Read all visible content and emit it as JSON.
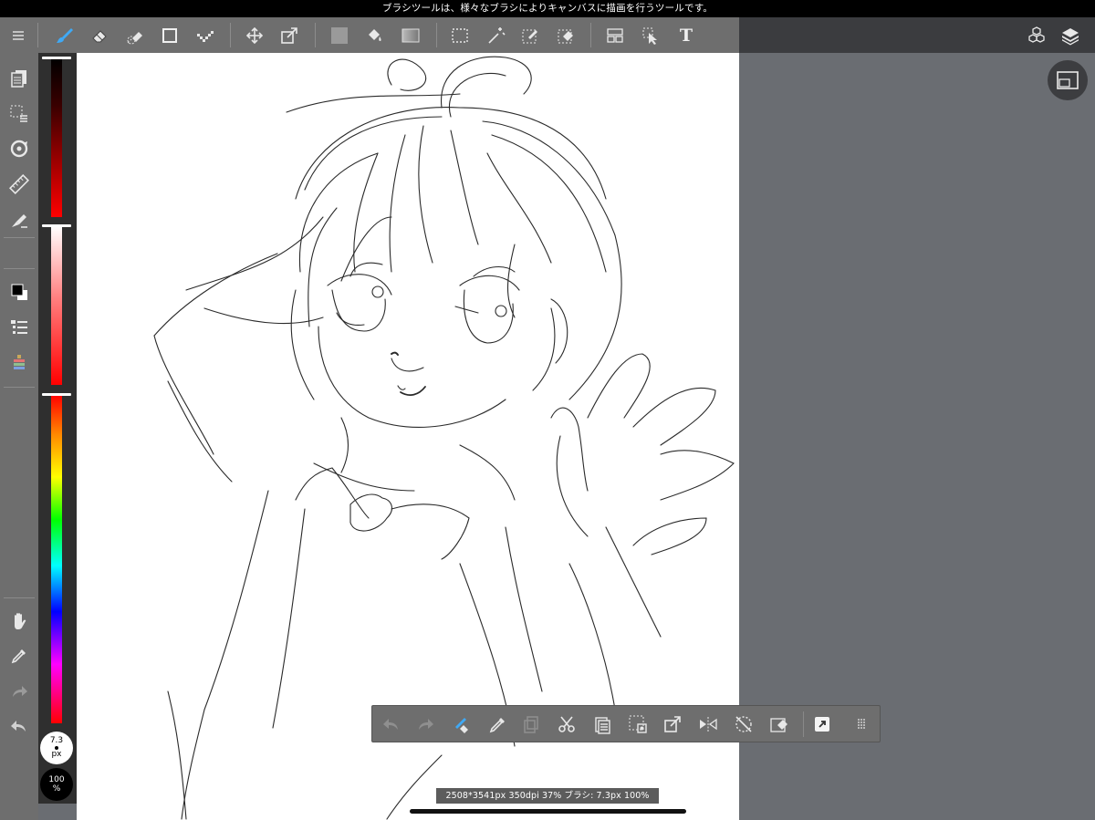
{
  "tip_bar": {
    "text": "ブラシツールは、様々なブラシによりキャンバスに描画を行うツールです。"
  },
  "toolbar": {
    "left_tools": [
      "menu-icon",
      "brush-icon",
      "eraser-icon",
      "blur-icon",
      "rectangle-icon",
      "dot-pen-icon"
    ],
    "transform_tools": [
      "move-icon",
      "transform-icon"
    ],
    "fill_tools": [
      "fill-color-icon",
      "bucket-icon",
      "gradient-icon"
    ],
    "select_tools": [
      "select-rect-icon",
      "magic-wand-icon",
      "select-pen-icon",
      "select-eraser-icon"
    ],
    "misc_tools": [
      "panel-icon",
      "operation-icon",
      "text-icon"
    ],
    "text_tool_label": "T",
    "right_tools": [
      "material-icon",
      "layers-icon"
    ]
  },
  "left_panel": {
    "items": [
      "page-icon",
      "selection-list-icon",
      "rotate-icon",
      "ruler-icon",
      "fill-pen-icon",
      "color-swatch-icon",
      "brush-list-icon",
      "color-palette-icon",
      "hand-icon",
      "eyedropper-icon",
      "redo-icon",
      "undo-icon"
    ]
  },
  "color_panel": {
    "brush_size_value": "7.3",
    "brush_size_unit": "px",
    "opacity_value": "100",
    "opacity_unit": "%",
    "current_color": "#000000",
    "secondary_color": "#ffffff"
  },
  "action_bar": {
    "items": [
      "undo-icon",
      "redo-icon",
      "clear-icon",
      "pen-icon",
      "copy-icon",
      "cut-icon",
      "paste-icon",
      "select-icon",
      "transform-icon",
      "flip-icon",
      "deselect-icon",
      "erase-selection-icon",
      "settings-icon",
      "grip-icon"
    ]
  },
  "info_bar": {
    "text": "2508*3541px 350dpi 37% ブラシ: 7.3px 100%"
  },
  "colors": {
    "toolbar": "#6e6e6e",
    "dark": "#3b3c3f",
    "canvas": "#ffffff",
    "accent": "#3fa9f5"
  }
}
